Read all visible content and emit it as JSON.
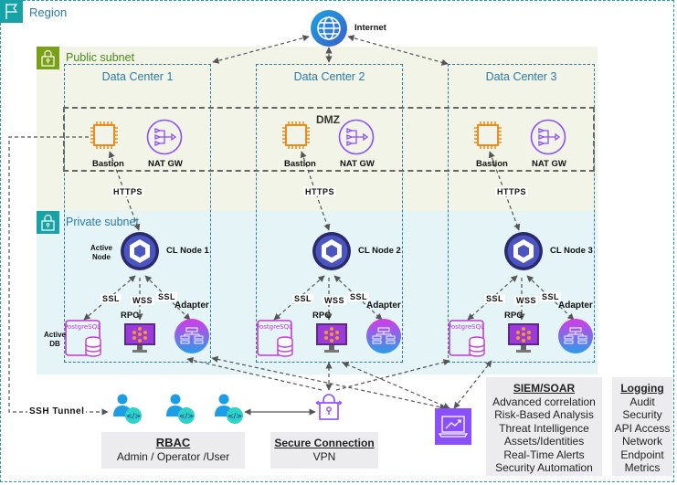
{
  "region": {
    "label": "Region"
  },
  "internet": {
    "label": "Internet"
  },
  "public_subnet": {
    "label": "Public subnet"
  },
  "private_subnet": {
    "label": "Private subnet"
  },
  "dmz": {
    "label": "DMZ"
  },
  "data_centers": [
    {
      "title": "Data Center 1",
      "bastion": "Bastion",
      "nat": "NAT GW",
      "https": "HTTPS",
      "node": "CL Node 1",
      "ssl_db": "SSL",
      "wss": "WSS",
      "ssl_adapter": "SSL",
      "rpc": "RPC",
      "adapter": "Adapter",
      "node_note": "Active\nNode",
      "db_note": "Active\nDB",
      "postgres": "PostgreSQL"
    },
    {
      "title": "Data Center 2",
      "bastion": "Bastion",
      "nat": "NAT GW",
      "https": "HTTPS",
      "node": "CL Node 2",
      "ssl_db": "SSL",
      "wss": "WSS",
      "ssl_adapter": "SSL",
      "rpc": "RPC",
      "adapter": "Adapter",
      "postgres": "PostgreSQL"
    },
    {
      "title": "Data Center 3",
      "bastion": "Bastion",
      "nat": "NAT GW",
      "https": "HTTPS",
      "node": "CL Node 3",
      "ssl_db": "SSL",
      "wss": "WSS",
      "ssl_adapter": "SSL",
      "rpc": "RPC",
      "adapter": "Adapter",
      "postgres": "PostgreSQL"
    }
  ],
  "ssh_tunnel": {
    "label": "SSH Tunnel"
  },
  "rbac": {
    "title": "RBAC",
    "subtitle": "Admin / Operator /User"
  },
  "secure_connection": {
    "title": "Secure Connection",
    "subtitle": "VPN"
  },
  "siem": {
    "title": "SIEM/SOAR",
    "items": [
      "Advanced correlation",
      "Risk-Based Analysis",
      "Threat Intelligence",
      "Assets/Identities",
      "Real-Time Alerts",
      "Security Automation"
    ]
  },
  "logging": {
    "title": "Logging",
    "items": [
      "Audit",
      "Security",
      "API Access",
      "Network",
      "Endpoint",
      "Metrics"
    ]
  },
  "colors": {
    "region": "#17a2a8",
    "public": "#7aa116",
    "bastion": "#e8830e",
    "nat": "#8c4fff",
    "chainlink": "#375bd2",
    "siem": "#8c4fff"
  }
}
